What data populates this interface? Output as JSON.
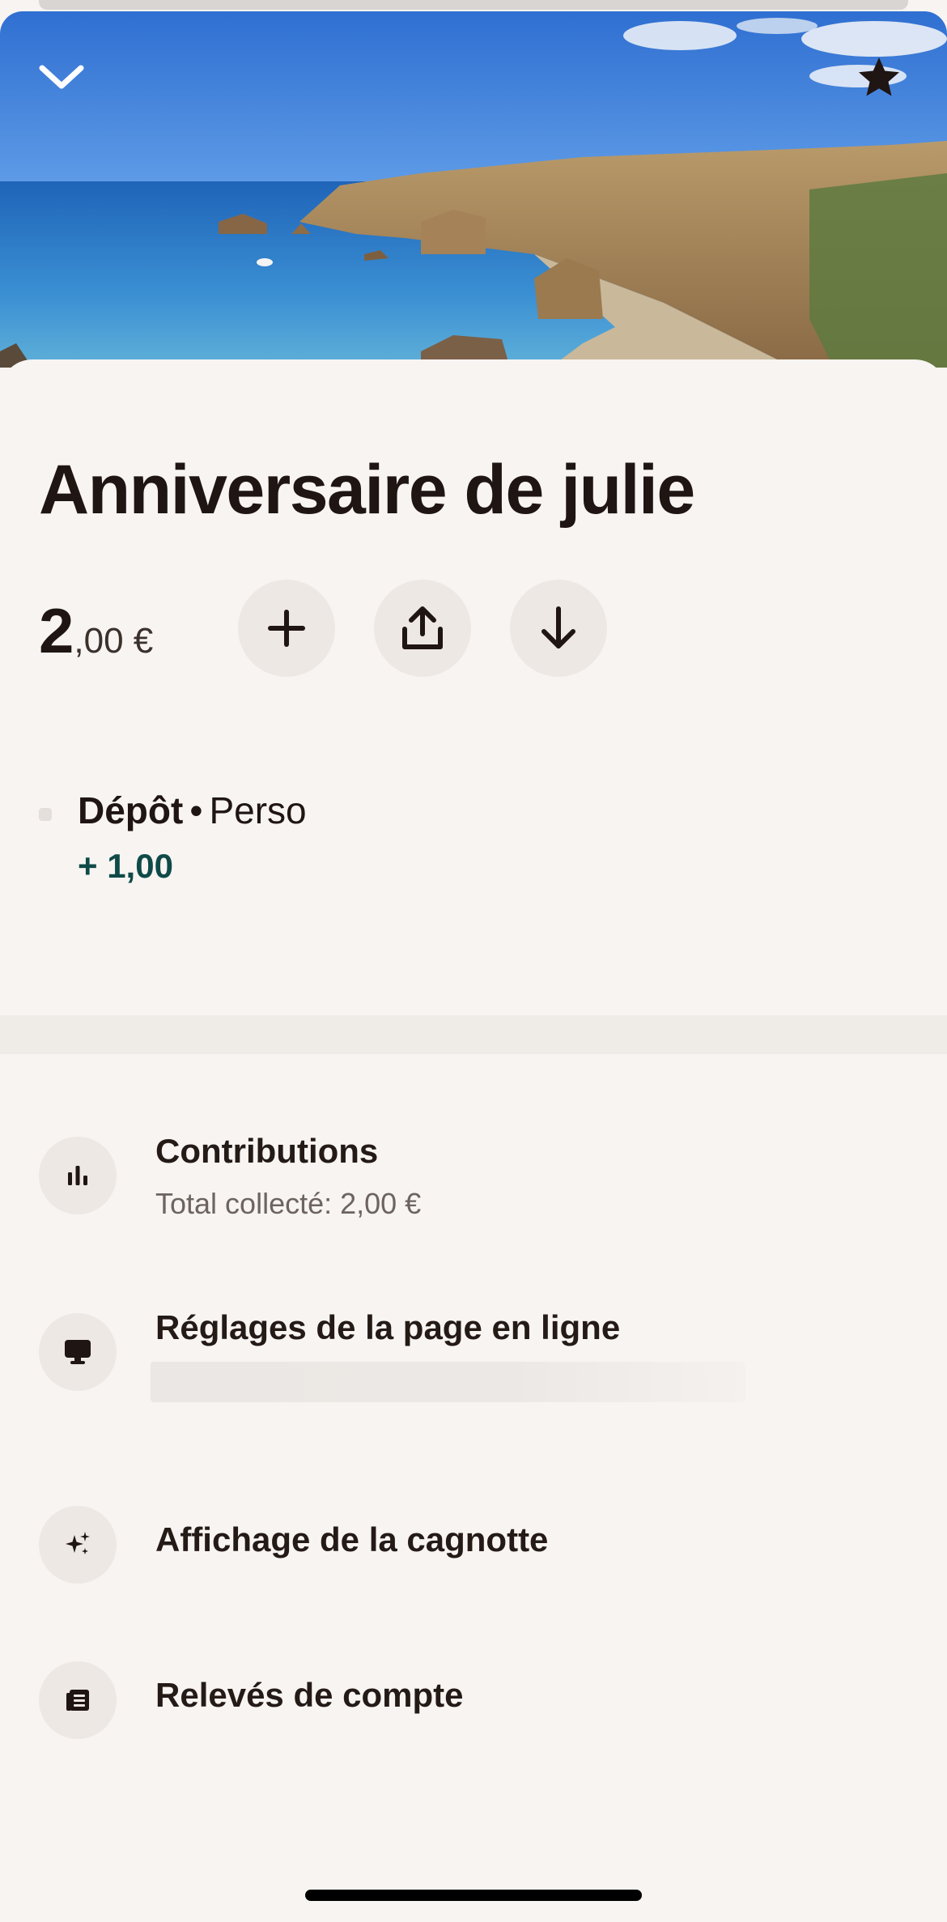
{
  "header": {
    "close_icon": "chevron-down-icon",
    "favorite_icon": "star-icon"
  },
  "pot": {
    "title": "Anniversaire de julie",
    "balance_int": "2",
    "balance_dec": ",00 €"
  },
  "actions": [
    {
      "name": "add",
      "icon": "plus-icon"
    },
    {
      "name": "share",
      "icon": "share-icon"
    },
    {
      "name": "withdraw",
      "icon": "arrow-down-icon"
    }
  ],
  "transaction": {
    "type": "Dépôt",
    "separator": "•",
    "account": "Perso",
    "amount": "+ 1,00"
  },
  "menu": {
    "contributions": {
      "label": "Contributions",
      "sub": "Total collecté: 2,00 €",
      "icon": "bar-chart-icon"
    },
    "online_page": {
      "label": "Réglages de la page en ligne",
      "icon": "monitor-icon"
    },
    "display": {
      "label": "Affichage de la cagnotte",
      "icon": "sparkles-icon"
    },
    "statements": {
      "label": "Relevés de compte",
      "icon": "document-icon"
    }
  },
  "colors": {
    "background": "#f7f4f2",
    "button_bg": "#ede8e3",
    "amount_positive": "#0f4a48",
    "text": "#1f1512"
  }
}
